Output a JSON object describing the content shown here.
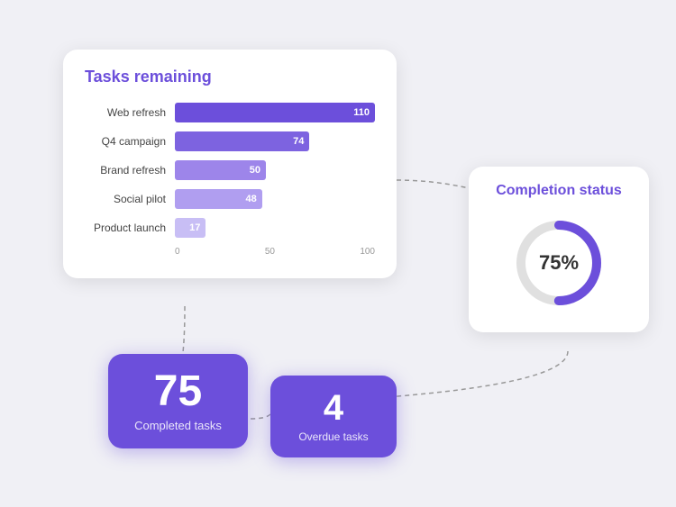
{
  "tasks_card": {
    "title": "Tasks remaining",
    "bars": [
      {
        "label": "Web refresh",
        "value": 110,
        "max": 110,
        "color": "#6c4fdb"
      },
      {
        "label": "Q4 campaign",
        "value": 74,
        "max": 110,
        "color": "#7d63e0"
      },
      {
        "label": "Brand refresh",
        "value": 50,
        "max": 110,
        "color": "#9d85ea"
      },
      {
        "label": "Social pilot",
        "value": 48,
        "max": 110,
        "color": "#b09ef0"
      },
      {
        "label": "Product launch",
        "value": 17,
        "max": 110,
        "color": "#c8bef5"
      }
    ],
    "axis_labels": [
      "0",
      "50",
      "100"
    ]
  },
  "completion_card": {
    "title": "Completion status",
    "percent": 75,
    "label": "75%",
    "arc_color": "#6c4fdb",
    "track_color": "#e0e0e0"
  },
  "completed_card": {
    "number": "75",
    "label": "Completed tasks"
  },
  "overdue_card": {
    "number": "4",
    "label": "Overdue tasks"
  }
}
